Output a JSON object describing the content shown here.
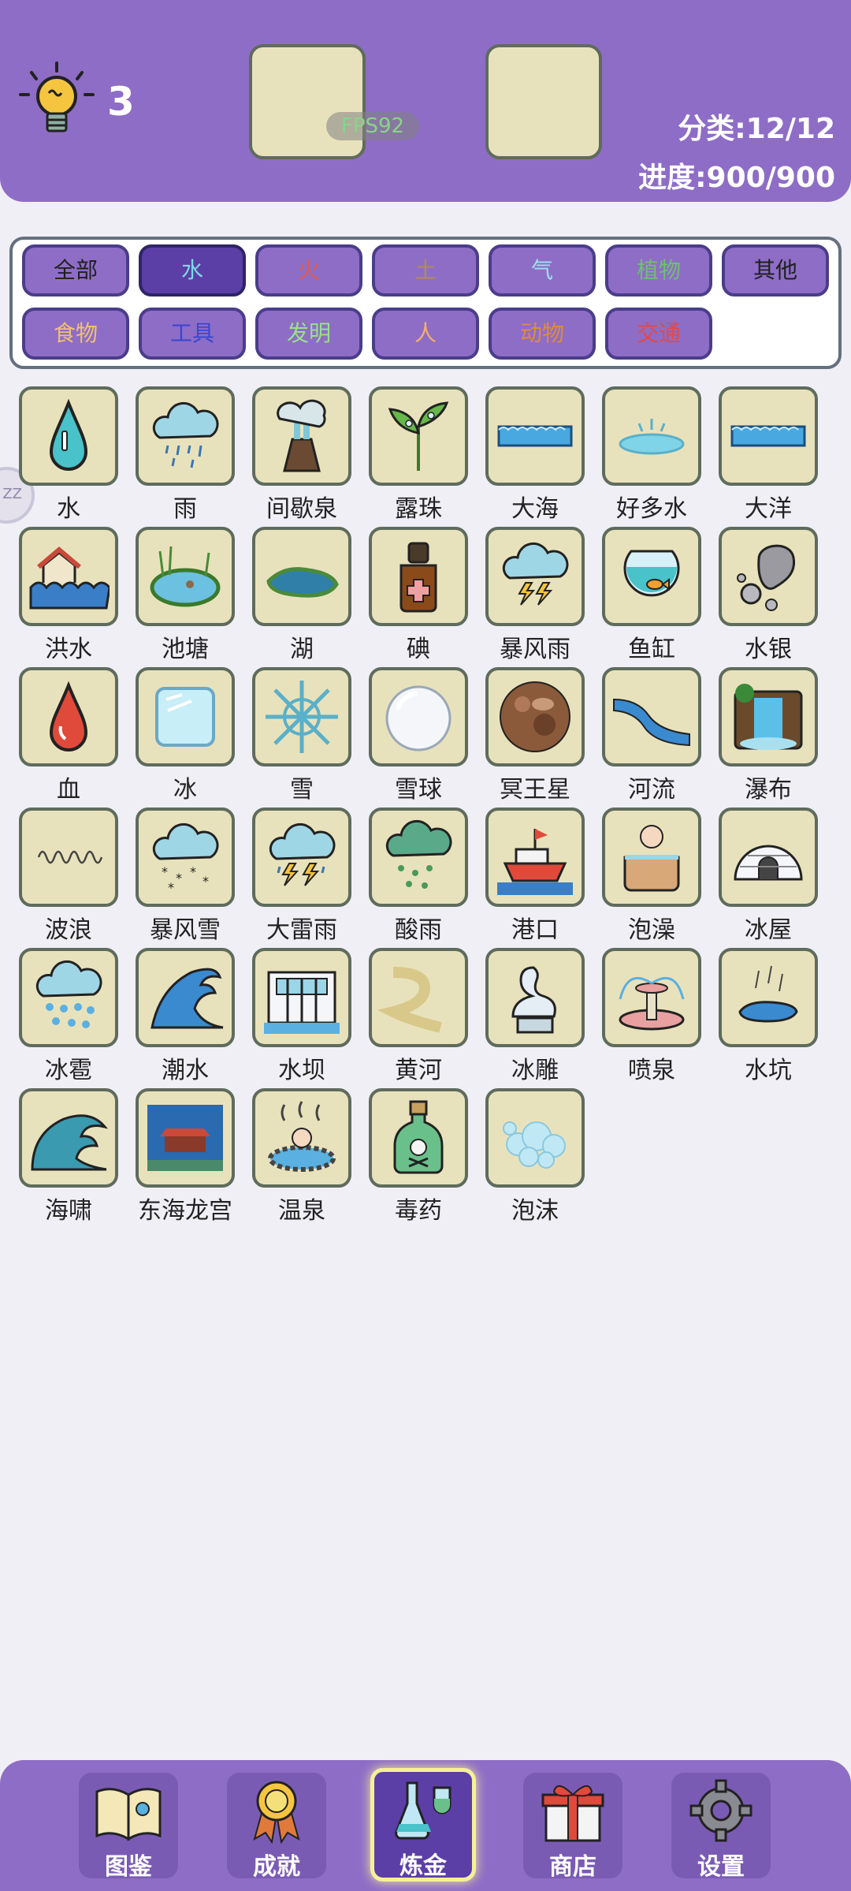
{
  "header": {
    "hint_count": "3",
    "fps": "FPS92",
    "category_stat": "分类:12/12",
    "progress_stat": "进度:900/900"
  },
  "categories": [
    {
      "label": "全部",
      "color": "#1f1f1f"
    },
    {
      "label": "水",
      "color": "#7fd8e8",
      "active": true
    },
    {
      "label": "火",
      "color": "#e05a4a"
    },
    {
      "label": "土",
      "color": "#b38a5a"
    },
    {
      "label": "气",
      "color": "#9ee0f0"
    },
    {
      "label": "植物",
      "color": "#6fbf70"
    },
    {
      "label": "其他",
      "color": "#1f1f1f"
    },
    {
      "label": "食物",
      "color": "#f0c070"
    },
    {
      "label": "工具",
      "color": "#3a46d0"
    },
    {
      "label": "发明",
      "color": "#9be08a"
    },
    {
      "label": "人",
      "color": "#f4b06a"
    },
    {
      "label": "动物",
      "color": "#e08a3a"
    },
    {
      "label": "交通",
      "color": "#e04a4a"
    }
  ],
  "items": [
    {
      "label": "水",
      "icon": "water-drop-icon"
    },
    {
      "label": "雨",
      "icon": "rain-cloud-icon"
    },
    {
      "label": "间歇泉",
      "icon": "geyser-icon"
    },
    {
      "label": "露珠",
      "icon": "dew-plant-icon"
    },
    {
      "label": "大海",
      "icon": "sea-wave-icon"
    },
    {
      "label": "好多水",
      "icon": "puddle-icon"
    },
    {
      "label": "大洋",
      "icon": "ocean-wave-icon"
    },
    {
      "label": "洪水",
      "icon": "flood-house-icon"
    },
    {
      "label": "池塘",
      "icon": "pond-icon"
    },
    {
      "label": "湖",
      "icon": "lake-icon"
    },
    {
      "label": "碘",
      "icon": "iodine-bottle-icon"
    },
    {
      "label": "暴风雨",
      "icon": "storm-cloud-icon"
    },
    {
      "label": "鱼缸",
      "icon": "fishbowl-icon"
    },
    {
      "label": "水银",
      "icon": "mercury-blob-icon"
    },
    {
      "label": "血",
      "icon": "blood-drop-icon"
    },
    {
      "label": "冰",
      "icon": "ice-cube-icon"
    },
    {
      "label": "雪",
      "icon": "snowflake-icon"
    },
    {
      "label": "雪球",
      "icon": "snowball-icon"
    },
    {
      "label": "冥王星",
      "icon": "pluto-planet-icon"
    },
    {
      "label": "河流",
      "icon": "river-icon"
    },
    {
      "label": "瀑布",
      "icon": "waterfall-icon"
    },
    {
      "label": "波浪",
      "icon": "wave-line-icon"
    },
    {
      "label": "暴风雪",
      "icon": "blizzard-cloud-icon"
    },
    {
      "label": "大雷雨",
      "icon": "thunderstorm-icon"
    },
    {
      "label": "酸雨",
      "icon": "acid-rain-icon"
    },
    {
      "label": "港口",
      "icon": "harbor-ship-icon"
    },
    {
      "label": "泡澡",
      "icon": "bath-tub-icon"
    },
    {
      "label": "冰屋",
      "icon": "igloo-icon"
    },
    {
      "label": "冰雹",
      "icon": "hail-cloud-icon"
    },
    {
      "label": "潮水",
      "icon": "tide-wave-icon"
    },
    {
      "label": "水坝",
      "icon": "dam-icon"
    },
    {
      "label": "黄河",
      "icon": "yellow-river-icon"
    },
    {
      "label": "冰雕",
      "icon": "ice-swan-icon"
    },
    {
      "label": "喷泉",
      "icon": "fountain-icon"
    },
    {
      "label": "水坑",
      "icon": "water-hole-icon"
    },
    {
      "label": "海啸",
      "icon": "tsunami-icon"
    },
    {
      "label": "东海龙宫",
      "icon": "dragon-palace-icon"
    },
    {
      "label": "温泉",
      "icon": "hot-spring-icon"
    },
    {
      "label": "毒药",
      "icon": "poison-bottle-icon"
    },
    {
      "label": "泡沫",
      "icon": "bubbles-icon"
    }
  ],
  "side_bubble": "ZZ",
  "nav": [
    {
      "label": "图鉴",
      "icon": "book-icon"
    },
    {
      "label": "成就",
      "icon": "medal-icon"
    },
    {
      "label": "炼金",
      "icon": "flask-icon",
      "active": true
    },
    {
      "label": "商店",
      "icon": "gift-icon"
    },
    {
      "label": "设置",
      "icon": "gear-icon"
    }
  ]
}
